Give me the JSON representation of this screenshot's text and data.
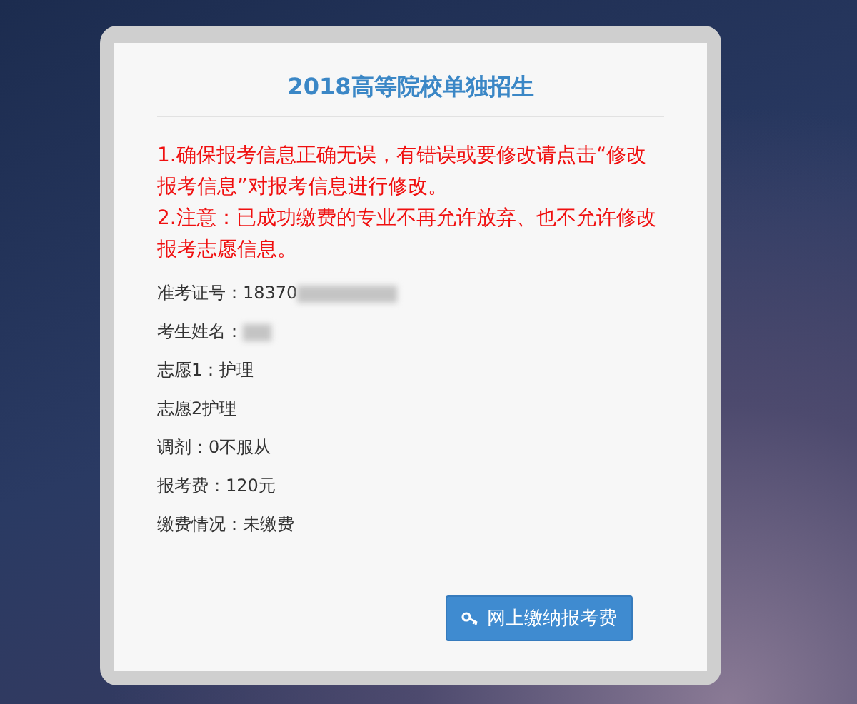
{
  "title": "2018高等院校单独招生",
  "notices": [
    "1.确保报考信息正确无误，有错误或要修改请点击“修改报考信息”对报考信息进行修改。",
    "2.注意：已成功缴费的专业不再允许放弃、也不允许修改报考志愿信息。"
  ],
  "fields": [
    {
      "text": "准考证号：18370",
      "redacted": true
    },
    {
      "text": "考生姓名：",
      "redacted": true
    },
    {
      "text": "志愿1：护理",
      "redacted": false
    },
    {
      "text": "志愿2护理",
      "redacted": false
    },
    {
      "text": "调剂：0不服从",
      "redacted": false
    },
    {
      "text": "报考费：120元",
      "redacted": false
    },
    {
      "text": "缴费情况：未缴费",
      "redacted": false
    }
  ],
  "pay_button": {
    "label": "网上缴纳报考费"
  }
}
